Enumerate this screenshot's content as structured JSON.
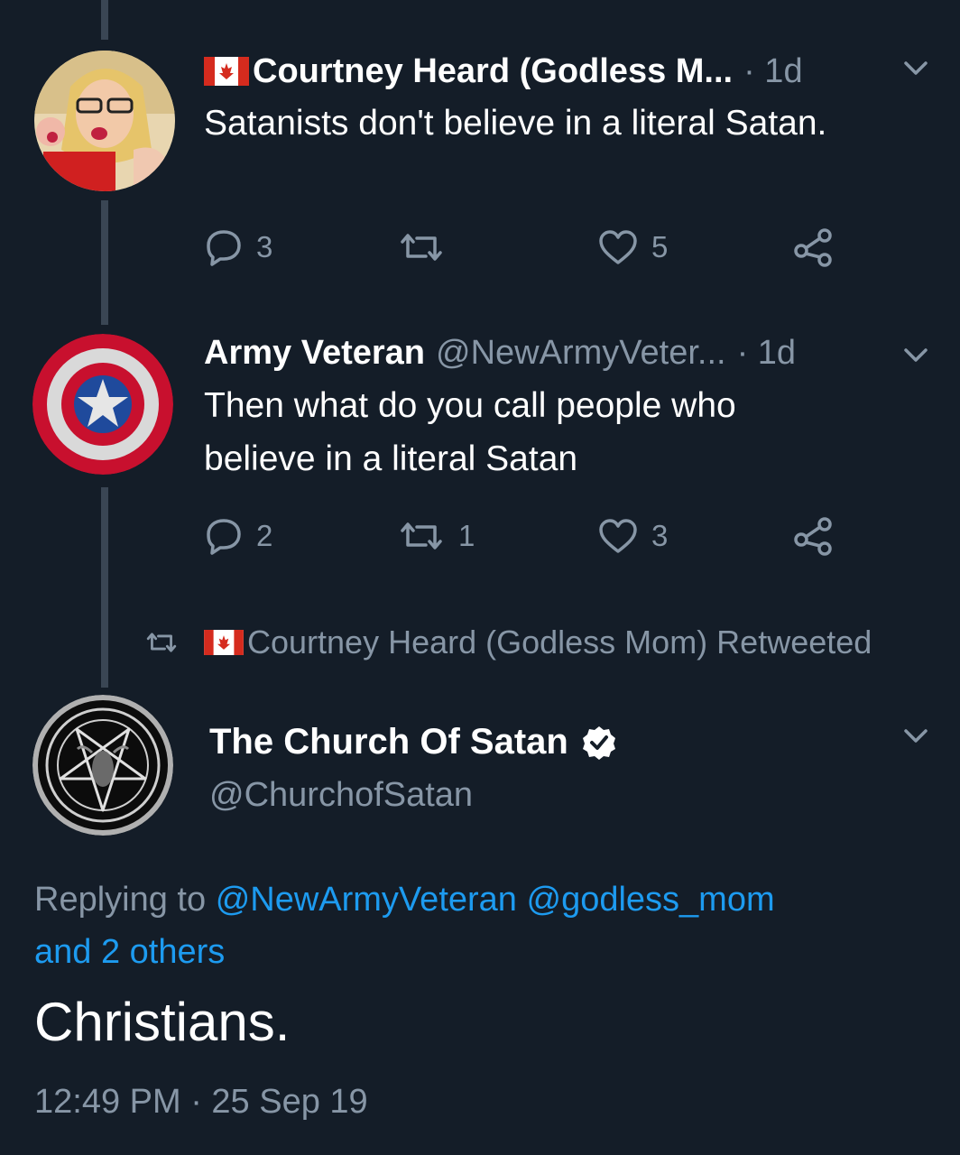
{
  "tweets": [
    {
      "name": "Courtney Heard (Godless M...",
      "handle": "",
      "time": "· 1d",
      "text": "Satanists don't believe in a literal Satan.",
      "replies": "3",
      "retweets": "",
      "likes": "5"
    },
    {
      "name": "Army Veteran",
      "handle": "@NewArmyVeter...",
      "time": "· 1d",
      "text_lines": [
        "Then what do you call people who",
        "believe in a literal Satan"
      ],
      "replies": "2",
      "retweets": "1",
      "likes": "3"
    }
  ],
  "retweeted_by": "Courtney Heard (Godless Mom) Retweeted",
  "main_tweet": {
    "name": "The Church Of Satan",
    "handle": "@ChurchofSatan",
    "replying_prefix": "Replying to",
    "reply_mentions": [
      "@NewArmyVeteran",
      "@godless_mom"
    ],
    "reply_others": "and 2 others",
    "text": "Christians.",
    "timestamp": "12:49 PM · 25 Sep 19"
  },
  "icons": {
    "reply": "reply-icon",
    "retweet": "retweet-icon",
    "like": "heart-icon",
    "share": "share-icon",
    "more": "chevron-down-icon",
    "verified": "verified-badge-icon"
  },
  "colors": {
    "background": "#141d28",
    "text_primary": "#ffffff",
    "text_secondary": "#8796a6",
    "link": "#1d9bf0",
    "thread_line": "#3a4654"
  }
}
